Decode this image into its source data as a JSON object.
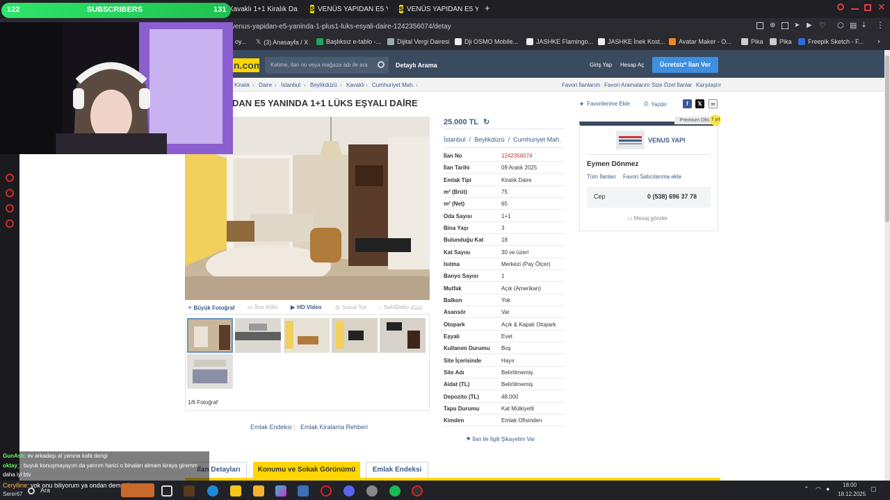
{
  "subscriber_widget": {
    "count_left": "122",
    "label": "SUBSCRIBERS",
    "count_right": "131"
  },
  "browser": {
    "tabs": [
      {
        "title": "Kavaklı 1+1 Kiralık Daire F"
      },
      {
        "title": "VENÜS YAPIDAN E5 YANI"
      },
      {
        "title": "VENÜS YAPIDAN E5 YANI"
      }
    ],
    "url": "venus-yapidan-e5-yaninda-1-plus1-luks-esyali-daire-1242356074/detay",
    "bookmarks": [
      "oy...",
      "(3) Anasayfa / X",
      "Başlıksız e-tablo -...",
      "Dijital Vergi Dairesi",
      "Dji OSMO Mobile...",
      "JASHKE Flamingo...",
      "JASHKE İnek Kost...",
      "Avatar Maker - O...",
      "Pika",
      "Pika",
      "Freepik Sketch - F..."
    ]
  },
  "site": {
    "logo_text": "n.com",
    "search_placeholder": "Kelime, ilan no veya mağaza adı ile ara",
    "detailed_search": "Detaylı Arama",
    "login": "Giriş Yap",
    "register": "Hesap Aç",
    "post_ad": "Ücretsiz* İlan Ver"
  },
  "breadcrumb": [
    "Kiralık",
    "Daire",
    "İstanbul",
    "Beylikdüzü",
    "Kavaklı",
    "Cumhuriyet Mah."
  ],
  "top_links": [
    "Favori İlanlarım",
    "Favori Aramalarım",
    "Size Özel İlanlar",
    "Karşılaştır"
  ],
  "listing": {
    "title": "DAN E5 YANINDA 1+1 LÜKS EŞYALI DAİRE",
    "add_favorite": "Favorilerime Ekle",
    "print": "Yazdır",
    "price": "25.000 TL",
    "location": [
      "İstanbul",
      "Beylikdüzü",
      "Cumhuriyet Mah."
    ],
    "photo_buttons": [
      "Büyük Fotoğraf",
      "İlan Kliki",
      "HD Video",
      "Sanal Tur",
      "SahiDeko"
    ],
    "photo_badge": "yeni",
    "photo_count": "1/6 Fotoğraf",
    "footer_links": [
      "Emlak Endeksi",
      "Emlak Kiralama Rehberi"
    ],
    "report": "İlan ile İlgili Şikayetim Var",
    "details": [
      {
        "k": "İlan No",
        "v": "1242356074"
      },
      {
        "k": "İlan Tarihi",
        "v": "09 Aralık 2025"
      },
      {
        "k": "Emlak Tipi",
        "v": "Kiralık Daire"
      },
      {
        "k": "m² (Brüt)",
        "v": "75"
      },
      {
        "k": "m² (Net)",
        "v": "65"
      },
      {
        "k": "Oda Sayısı",
        "v": "1+1"
      },
      {
        "k": "Bina Yaşı",
        "v": "3"
      },
      {
        "k": "Bulunduğu Kat",
        "v": "18"
      },
      {
        "k": "Kat Sayısı",
        "v": "30 ve üzeri"
      },
      {
        "k": "Isıtma",
        "v": "Merkezi (Pay Ölçer)"
      },
      {
        "k": "Banyo Sayısı",
        "v": "1"
      },
      {
        "k": "Mutfak",
        "v": "Açık (Amerikan)"
      },
      {
        "k": "Balkon",
        "v": "Yok"
      },
      {
        "k": "Asansör",
        "v": "Var"
      },
      {
        "k": "Otopark",
        "v": "Açık & Kapalı Otopark"
      },
      {
        "k": "Eşyalı",
        "v": "Evet"
      },
      {
        "k": "Kullanım Durumu",
        "v": "Boş"
      },
      {
        "k": "Site İçerisinde",
        "v": "Hayır"
      },
      {
        "k": "Site Adı",
        "v": "Belirtilmemiş"
      },
      {
        "k": "Aidat (TL)",
        "v": "Belirtilmemiş"
      },
      {
        "k": "Depozito (TL)",
        "v": "48.000"
      },
      {
        "k": "Tapu Durumu",
        "v": "Kat Mülkiyetli"
      },
      {
        "k": "Kimden",
        "v": "Emlak Ofisinden"
      }
    ]
  },
  "seller": {
    "premium": "Premium Ofis",
    "premium_badge": "7 yıl",
    "office": "VENUS YAPI",
    "agent": "Eymen Dönmez",
    "all_ads": "Tüm İlanları",
    "favorite_seller": "Favori Satıcılarıma ekle",
    "phone_label": "Cep",
    "phone": "0 (538) 696 37 78",
    "message": "Mesaj gönder"
  },
  "bottom_tabs": [
    "İlan Detayları",
    "Konumu ve Sokak Görünümü",
    "Emlak Endeksi"
  ],
  "chat": [
    {
      "user": "GunAsh",
      "msg": "ev arkadaşı al yanına kafa dengi"
    },
    {
      "user": "oktay_",
      "msg": "buyuk konuşmayayım da yatırım harici o binaları almam kiraya giremm"
    },
    {
      "user": "",
      "msg": "daha iyi btv"
    },
    {
      "user": "Cerylline",
      "msg": "yok onu biliyorum ya ondan demedim"
    }
  ],
  "taskbar": {
    "search": "Ara",
    "time": "18:00",
    "date": "18.12.2025",
    "user": "Serer67"
  },
  "colors": {
    "brand_yellow": "#ffd600",
    "header_blue": "#3a4a5f",
    "link_blue": "#3b5c8a",
    "subscriber_green": "#2ee66a"
  }
}
